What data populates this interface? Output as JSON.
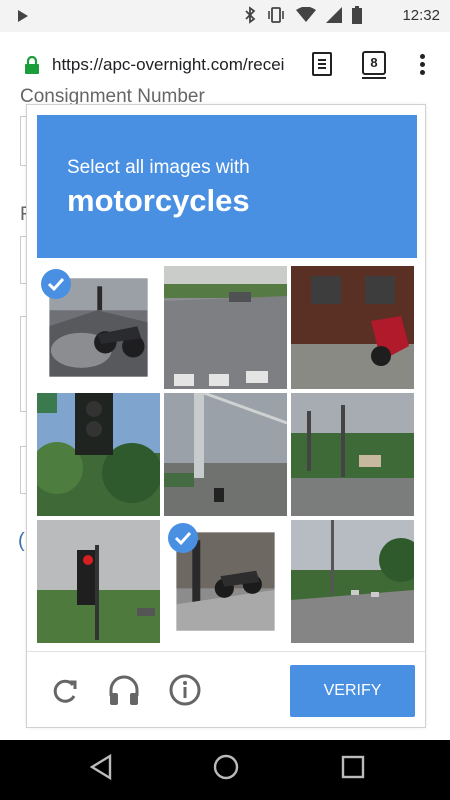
{
  "statusbar": {
    "time": "12:32"
  },
  "browser": {
    "url": "https://apc-overnight.com/recei",
    "tab_count": "8"
  },
  "page": {
    "label_top": "Consignment Number",
    "label_r": "R",
    "paren": "("
  },
  "captcha": {
    "instruction": "Select all images with",
    "target": "motorcycles",
    "verify_label": "VERIFY",
    "tiles": [
      {
        "selected": true
      },
      {
        "selected": false
      },
      {
        "selected": false
      },
      {
        "selected": false
      },
      {
        "selected": false
      },
      {
        "selected": false
      },
      {
        "selected": false
      },
      {
        "selected": true
      },
      {
        "selected": false
      }
    ]
  },
  "colors": {
    "accent": "#4a90e2",
    "lock_green": "#1a9e3a"
  },
  "icons": {
    "reload": "reload-icon",
    "audio": "headphones-icon",
    "info": "info-icon"
  }
}
